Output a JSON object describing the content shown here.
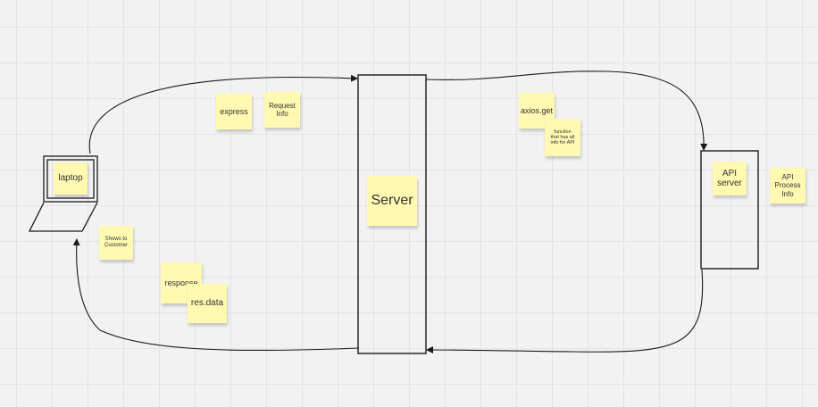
{
  "colors": {
    "sticky": "#fff9b1",
    "line": "#1a1a1a",
    "background": "#f2f2f2"
  },
  "icons": {
    "client": "laptop-icon"
  },
  "notes": {
    "laptop": "laptop",
    "express": "express",
    "request_info": "Request\nInfo",
    "shows_to_customer": "Shows to\nCustomer",
    "response": "response",
    "res_data": "res.data",
    "server": "Server",
    "axios_get": "axios.get",
    "function_info": "function\nthat has all\ninfo for API",
    "api_server": "API\nserver",
    "api_process_info": "API\nProcess\nInfo"
  }
}
